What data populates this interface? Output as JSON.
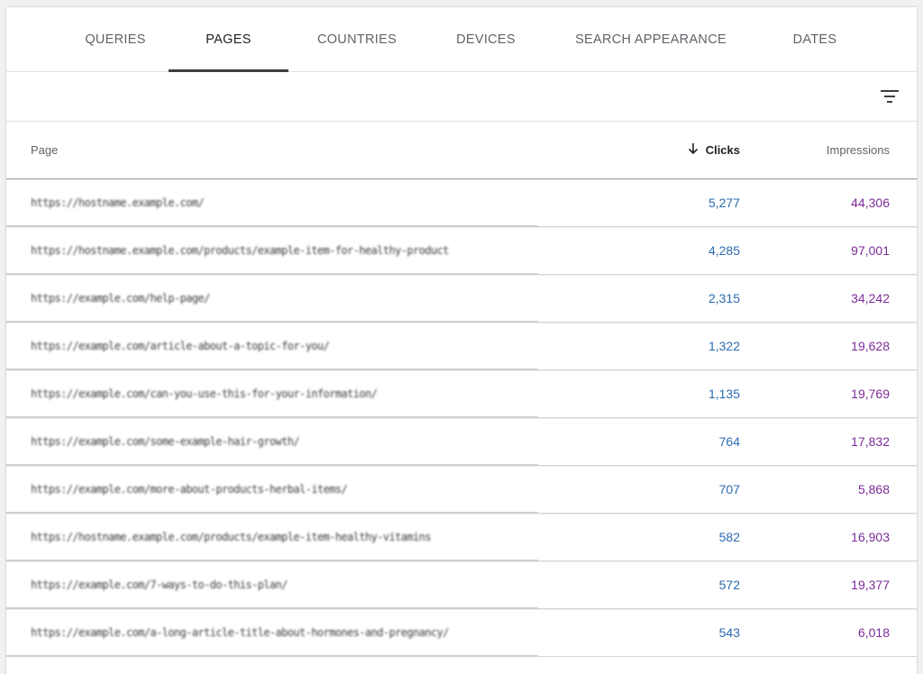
{
  "tabs": [
    {
      "label": "QUERIES",
      "active": false
    },
    {
      "label": "PAGES",
      "active": true
    },
    {
      "label": "COUNTRIES",
      "active": false
    },
    {
      "label": "DEVICES",
      "active": false
    },
    {
      "label": "SEARCH APPEARANCE",
      "active": false
    },
    {
      "label": "DATES",
      "active": false
    }
  ],
  "toolbar": {
    "filter_icon": "filter-list-icon"
  },
  "table": {
    "columns": {
      "page": "Page",
      "clicks": "Clicks",
      "impressions": "Impressions"
    },
    "sort": {
      "column": "clicks",
      "direction": "descending"
    },
    "rows": [
      {
        "page": "https://hostname.example.com/",
        "clicks": "5,277",
        "impressions": "44,306"
      },
      {
        "page": "https://hostname.example.com/products/example-item-for-healthy-product",
        "clicks": "4,285",
        "impressions": "97,001"
      },
      {
        "page": "https://example.com/help-page/",
        "clicks": "2,315",
        "impressions": "34,242"
      },
      {
        "page": "https://example.com/article-about-a-topic-for-you/",
        "clicks": "1,322",
        "impressions": "19,628"
      },
      {
        "page": "https://example.com/can-you-use-this-for-your-information/",
        "clicks": "1,135",
        "impressions": "19,769"
      },
      {
        "page": "https://example.com/some-example-hair-growth/",
        "clicks": "764",
        "impressions": "17,832"
      },
      {
        "page": "https://example.com/more-about-products-herbal-items/",
        "clicks": "707",
        "impressions": "5,868"
      },
      {
        "page": "https://hostname.example.com/products/example-item-healthy-vitamins",
        "clicks": "582",
        "impressions": "16,903"
      },
      {
        "page": "https://example.com/7-ways-to-do-this-plan/",
        "clicks": "572",
        "impressions": "19,377"
      },
      {
        "page": "https://example.com/a-long-article-title-about-hormones-and-pregnancy/",
        "clicks": "543",
        "impressions": "6,018"
      }
    ]
  },
  "colors": {
    "clicks": "#2b6bb0",
    "impressions": "#7b2c98",
    "active_tab_indicator": "#3c4043"
  }
}
